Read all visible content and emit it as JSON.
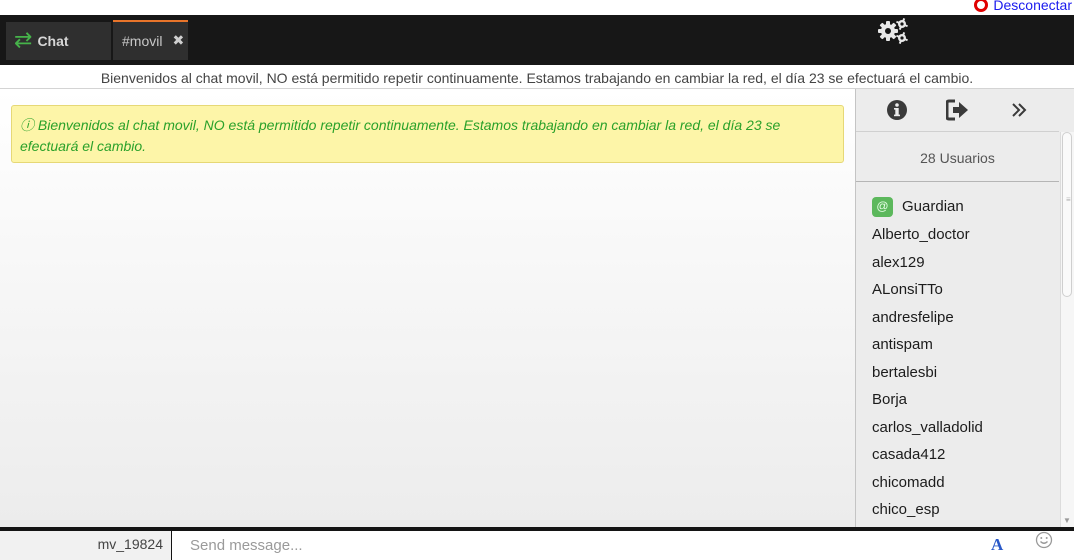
{
  "topbar": {
    "disconnect_label": "Desconectar"
  },
  "tabs": [
    {
      "label": "Chat",
      "icon": "swap-arrows-icon"
    },
    {
      "label": "#movil",
      "close_icon": "close-icon"
    }
  ],
  "header": {
    "settings_icon": "gears-icon"
  },
  "announcement": "Bienvenidos al chat movil, NO está permitido repetir continuamente. Estamos trabajando en cambiar la red, el día 23 se efectuará el cambio.",
  "motd": {
    "icon": "ⓘ",
    "text": "Bienvenidos al chat movil, NO está permitido repetir continuamente. Estamos trabajando en cambiar la red, el día 23 se efectuará el cambio."
  },
  "sidebar": {
    "toolbar": [
      "info-icon",
      "exit-icon",
      "double-chevron-right-icon"
    ],
    "user_count": "28 Usuarios",
    "op_badge": "@",
    "users": [
      "Guardian",
      "Alberto_doctor",
      "alex129",
      "ALonsiTTo",
      "andresfelipe",
      "antispam",
      "bertalesbi",
      "Borja",
      "carlos_valladolid",
      "casada412",
      "chicomadd",
      "chico_esp"
    ]
  },
  "composer": {
    "nick": "mv_19824",
    "placeholder": "Send message...",
    "value": "",
    "format_label": "A"
  },
  "colors": {
    "header_bg": "#171717",
    "tab_accent": "#e8742a",
    "chat_icon": "#46b34a",
    "motd_bg": "#fdf5a8",
    "motd_text": "#2aa12a",
    "op_badge": "#5cb85c",
    "disconnect_link": "#1a1aee",
    "disconnect_icon": "#e00000"
  }
}
